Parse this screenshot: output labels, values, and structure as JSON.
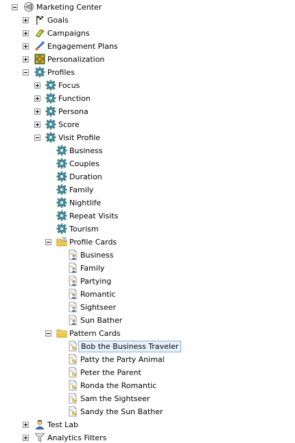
{
  "tree": {
    "root": {
      "label": "Marketing Center",
      "icon": "marketing-center-icon",
      "expanded": true
    },
    "goals": {
      "label": "Goals",
      "icon": "flag-icon"
    },
    "campaigns": {
      "label": "Campaigns",
      "icon": "campaign-icon"
    },
    "engagement_plans": {
      "label": "Engagement Plans",
      "icon": "engagement-plan-icon"
    },
    "personalization": {
      "label": "Personalization",
      "icon": "personalization-grid-icon"
    },
    "profiles": {
      "label": "Profiles",
      "icon": "profile-gear-icon",
      "expanded": true,
      "focus": {
        "label": "Focus"
      },
      "function": {
        "label": "Function"
      },
      "persona": {
        "label": "Persona"
      },
      "score": {
        "label": "Score"
      },
      "visit_profile": {
        "label": "Visit Profile",
        "expanded": true,
        "keys": [
          "Business",
          "Couples",
          "Duration",
          "Family",
          "Nightlife",
          "Repeat Visits",
          "Tourism"
        ],
        "profile_cards": {
          "label": "Profile Cards",
          "icon": "profile-cards-folder-icon",
          "items": [
            "Business",
            "Family",
            "Partying",
            "Romantic",
            "Sightseer",
            "Sun Bather"
          ]
        },
        "pattern_cards": {
          "label": "Pattern Cards",
          "icon": "folder-icon",
          "items": [
            "Bob the Business Traveler",
            "Patty the Party Animal",
            "Peter the Parent",
            "Ronda the Romantic",
            "Sam the Sightseer",
            "Sandy the Sun Bather"
          ],
          "selected": "Bob the Business Traveler"
        }
      }
    },
    "test_lab": {
      "label": "Test Lab",
      "icon": "test-lab-user-icon"
    },
    "analytics_filters": {
      "label": "Analytics Filters",
      "icon": "funnel-filter-icon"
    }
  },
  "colors": {
    "selection_border": "#84acdd",
    "selection_fill": "#e8f2fc",
    "gear": "#4a9aa8",
    "folder": "#f2c94c"
  }
}
